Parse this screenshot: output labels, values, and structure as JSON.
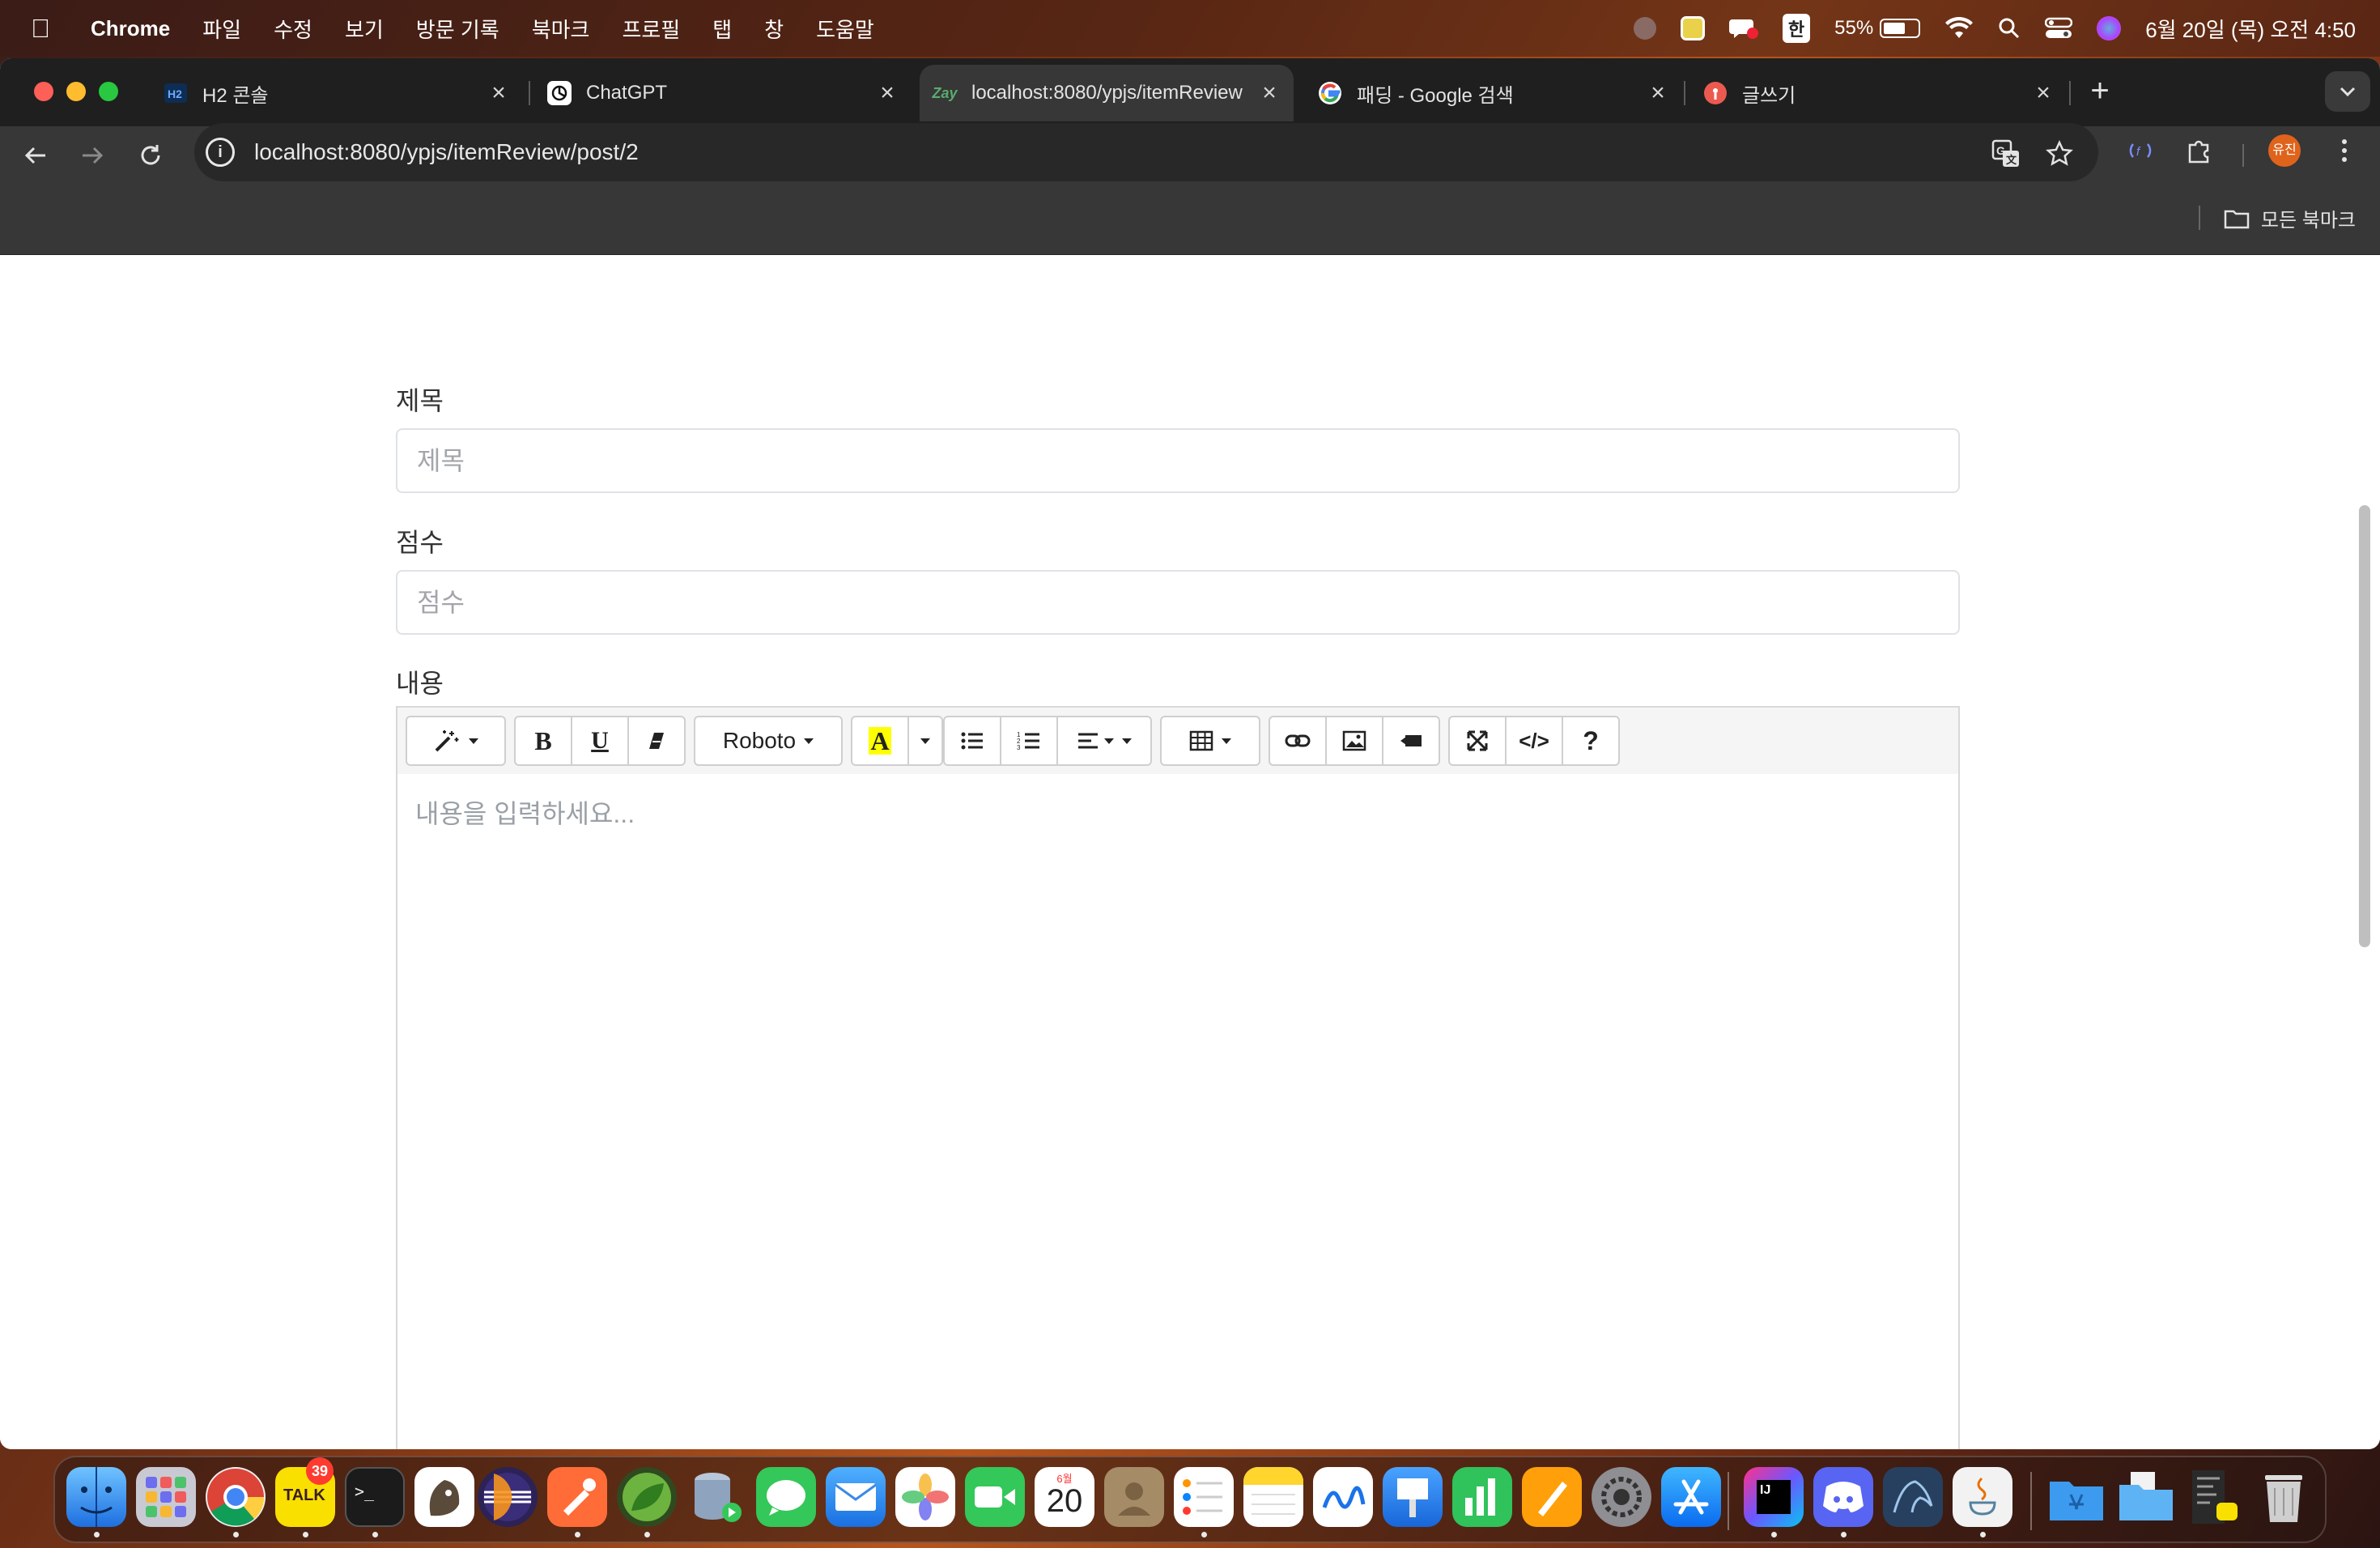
{
  "menubar": {
    "app_name": "Chrome",
    "items": [
      "파일",
      "수정",
      "보기",
      "방문 기록",
      "북마크",
      "프로필",
      "탭",
      "창",
      "도움말"
    ],
    "battery": "55%",
    "input_method": "한",
    "datetime": "6월 20일 (목) 오전 4:50"
  },
  "tabs": [
    {
      "title": "H2 콘솔",
      "favicon": "h2-icon"
    },
    {
      "title": "ChatGPT",
      "favicon": "chatgpt-icon"
    },
    {
      "title": "localhost:8080/ypjs/itemReview",
      "favicon": "zay-icon",
      "favicon_text": "Zay",
      "active": true
    },
    {
      "title": "패딩 - Google 검색",
      "favicon": "google-icon"
    },
    {
      "title": "글쓰기",
      "favicon": "writing-icon"
    }
  ],
  "toolbar": {
    "url": "localhost:8080/ypjs/itemReview/post/2",
    "profile_initials": "유진"
  },
  "bookmarks": {
    "all_label": "모든 북마크"
  },
  "form": {
    "title_label": "제목",
    "title_placeholder": "제목",
    "score_label": "점수",
    "score_placeholder": "점수",
    "content_label": "내용",
    "content_placeholder": "내용을 입력하세요..."
  },
  "editor_toolbar": {
    "style": "magic-wand-icon",
    "bold": "B",
    "underline": "U",
    "clear": "eraser-icon",
    "font_name": "Roboto",
    "color": "A",
    "ul": "unordered-list-icon",
    "ol": "ordered-list-icon",
    "paragraph": "align-left-icon",
    "table": "table-icon",
    "link": "link-icon",
    "picture": "picture-icon",
    "video": "video-icon",
    "fullscreen": "fullscreen-icon",
    "codeview": "</>",
    "help": "?"
  },
  "dock": {
    "kakaotalk_badge": "39",
    "kakaotalk_label": "TALK",
    "calendar_month": "6월",
    "calendar_day": "20",
    "apps": [
      "finder",
      "launchpad",
      "chrome",
      "kakaotalk",
      "terminal",
      "sequel-ace",
      "eclipse",
      "postman",
      "spring-tools",
      "database",
      "messages",
      "mail",
      "photos",
      "facetime",
      "calendar",
      "contacts",
      "reminders",
      "notes",
      "freeform",
      "keynote",
      "numbers",
      "pages",
      "system-settings",
      "app-store",
      "intellij",
      "discord",
      "mysql-workbench",
      "java",
      "applications-folder",
      "documents-folder",
      "downloads-stack",
      "trash"
    ]
  },
  "colors": {
    "accent_highlight": "#ffff00",
    "tab_bg": "#1f1f1f",
    "toolbar_bg": "#373737",
    "profile_bg": "#e0631c"
  }
}
